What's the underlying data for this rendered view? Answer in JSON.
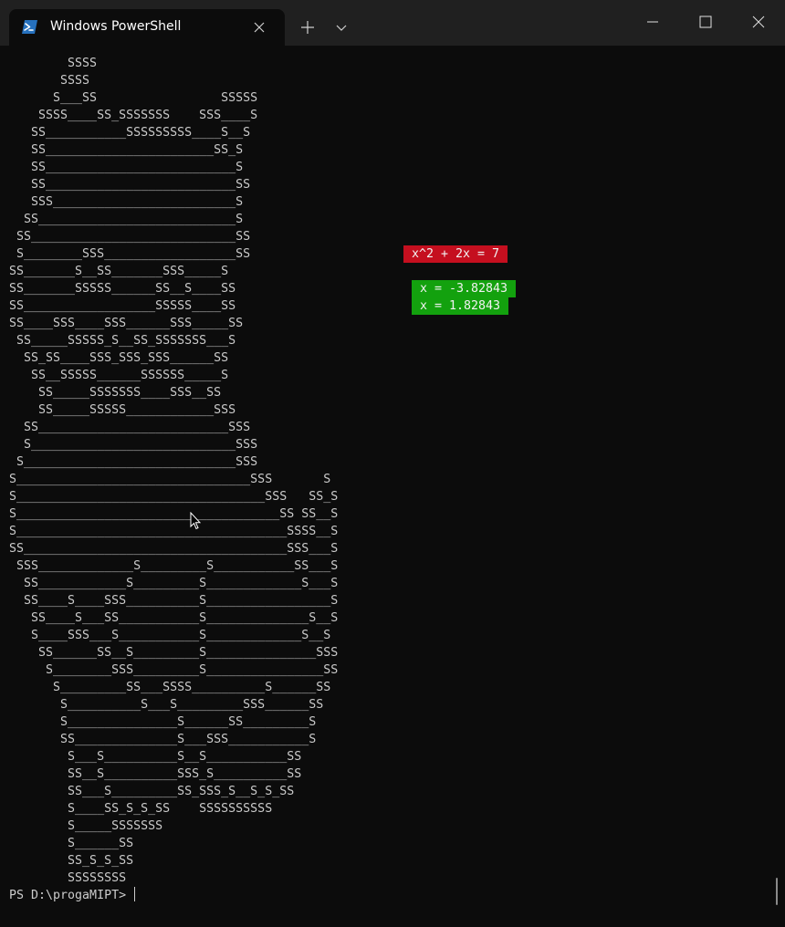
{
  "window": {
    "tab_title": "Windows PowerShell",
    "icons": {
      "app": "powershell-icon",
      "tab_close": "close-icon",
      "new_tab": "plus-icon",
      "dropdown": "chevron-down-icon",
      "minimize": "minimize-icon",
      "maximize": "maximize-icon",
      "close": "close-icon"
    }
  },
  "terminal": {
    "art_lines": [
      "        SSSS",
      "       SSSS",
      "      S___SS                 SSSSS",
      "    SSSS____SS_SSSSSSS    SSS____S",
      "   SS___________SSSSSSSSS____S__S",
      "   SS_______________________SS_S",
      "   SS__________________________S",
      "   SS__________________________SS",
      "   SSS_________________________S",
      "  SS___________________________S",
      " SS____________________________SS",
      " S________SSS__________________SS",
      "SS_______S__SS_______SSS_____S",
      "SS_______SSSSS______SS__S____SS",
      "SS__________________SSSSS____SS",
      "SS____SSS____SSS______SSS_____SS",
      " SS_____SSSSS_S__SS_SSSSSSS___S",
      "  SS_SS____SSS_SSS_SSS______SS",
      "   SS__SSSSS______SSSSSS_____S",
      "    SS_____SSSSSSS____SSS__SS",
      "    SS_____SSSSS____________SSS",
      "  SS__________________________SSS",
      "  S____________________________SSS",
      " S_____________________________SSS",
      "S________________________________SSS       S",
      "S__________________________________SSS   SS_S",
      "S____________________________________SS SS__S",
      "S_____________________________________SSSS__S",
      "SS____________________________________SSS___S",
      " SSS_____________S_________S___________SS___S",
      "  SS____________S_________S_____________S___S",
      "  SS____S____SSS__________S_________________S",
      "   SS____S___SS___________S______________S__S",
      "   S____SSS___S___________S_____________S__S",
      "    SS______SS__S_________S_______________SSS",
      "     S________SSS_________S________________SS",
      "      S_________SS___SSSS__________S______SS",
      "       S__________S___S_________SSS______SS",
      "       S_______________S______SS_________S",
      "       SS______________S___SSS___________S",
      "        S___S__________S__S___________SS",
      "        SS__S__________SSS_S__________SS",
      "        SS___S_________SS_SSS_S__S_S_SS",
      "        S____SS_S_S_SS    SSSSSSSSSS",
      "        S_____SSSSSSS",
      "        S______SS",
      "        SS_S_S_SS",
      "        SSSSSSSS"
    ],
    "equation": "x^2 + 2x = 7",
    "root_1": "x = -3.82843",
    "root_2": "x = 1.82843",
    "prompt": "PS D:\\progaMIPT> ",
    "colors": {
      "background": "#0c0c0c",
      "text": "#cccccc",
      "equation_bg": "#c50f1f",
      "roots_bg": "#13a10e"
    }
  }
}
